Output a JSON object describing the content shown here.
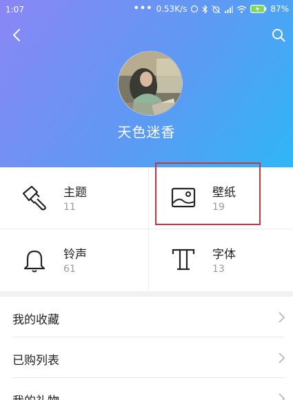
{
  "status_bar": {
    "time": "1:07",
    "speed": "0.53K/s",
    "battery": "87%"
  },
  "profile": {
    "username": "天色迷香"
  },
  "categories": [
    {
      "title": "主题",
      "count": "11",
      "icon": "brush-icon"
    },
    {
      "title": "壁纸",
      "count": "19",
      "icon": "wallpaper-icon"
    },
    {
      "title": "铃声",
      "count": "61",
      "icon": "bell-icon"
    },
    {
      "title": "字体",
      "count": "13",
      "icon": "font-icon"
    }
  ],
  "menu": [
    {
      "label": "我的收藏"
    },
    {
      "label": "已购列表"
    },
    {
      "label": "我的礼物"
    }
  ],
  "colors": {
    "header_gradient_start": "#8a86f5",
    "header_gradient_end": "#2fb6f6",
    "highlight_box": "#c8343c"
  }
}
